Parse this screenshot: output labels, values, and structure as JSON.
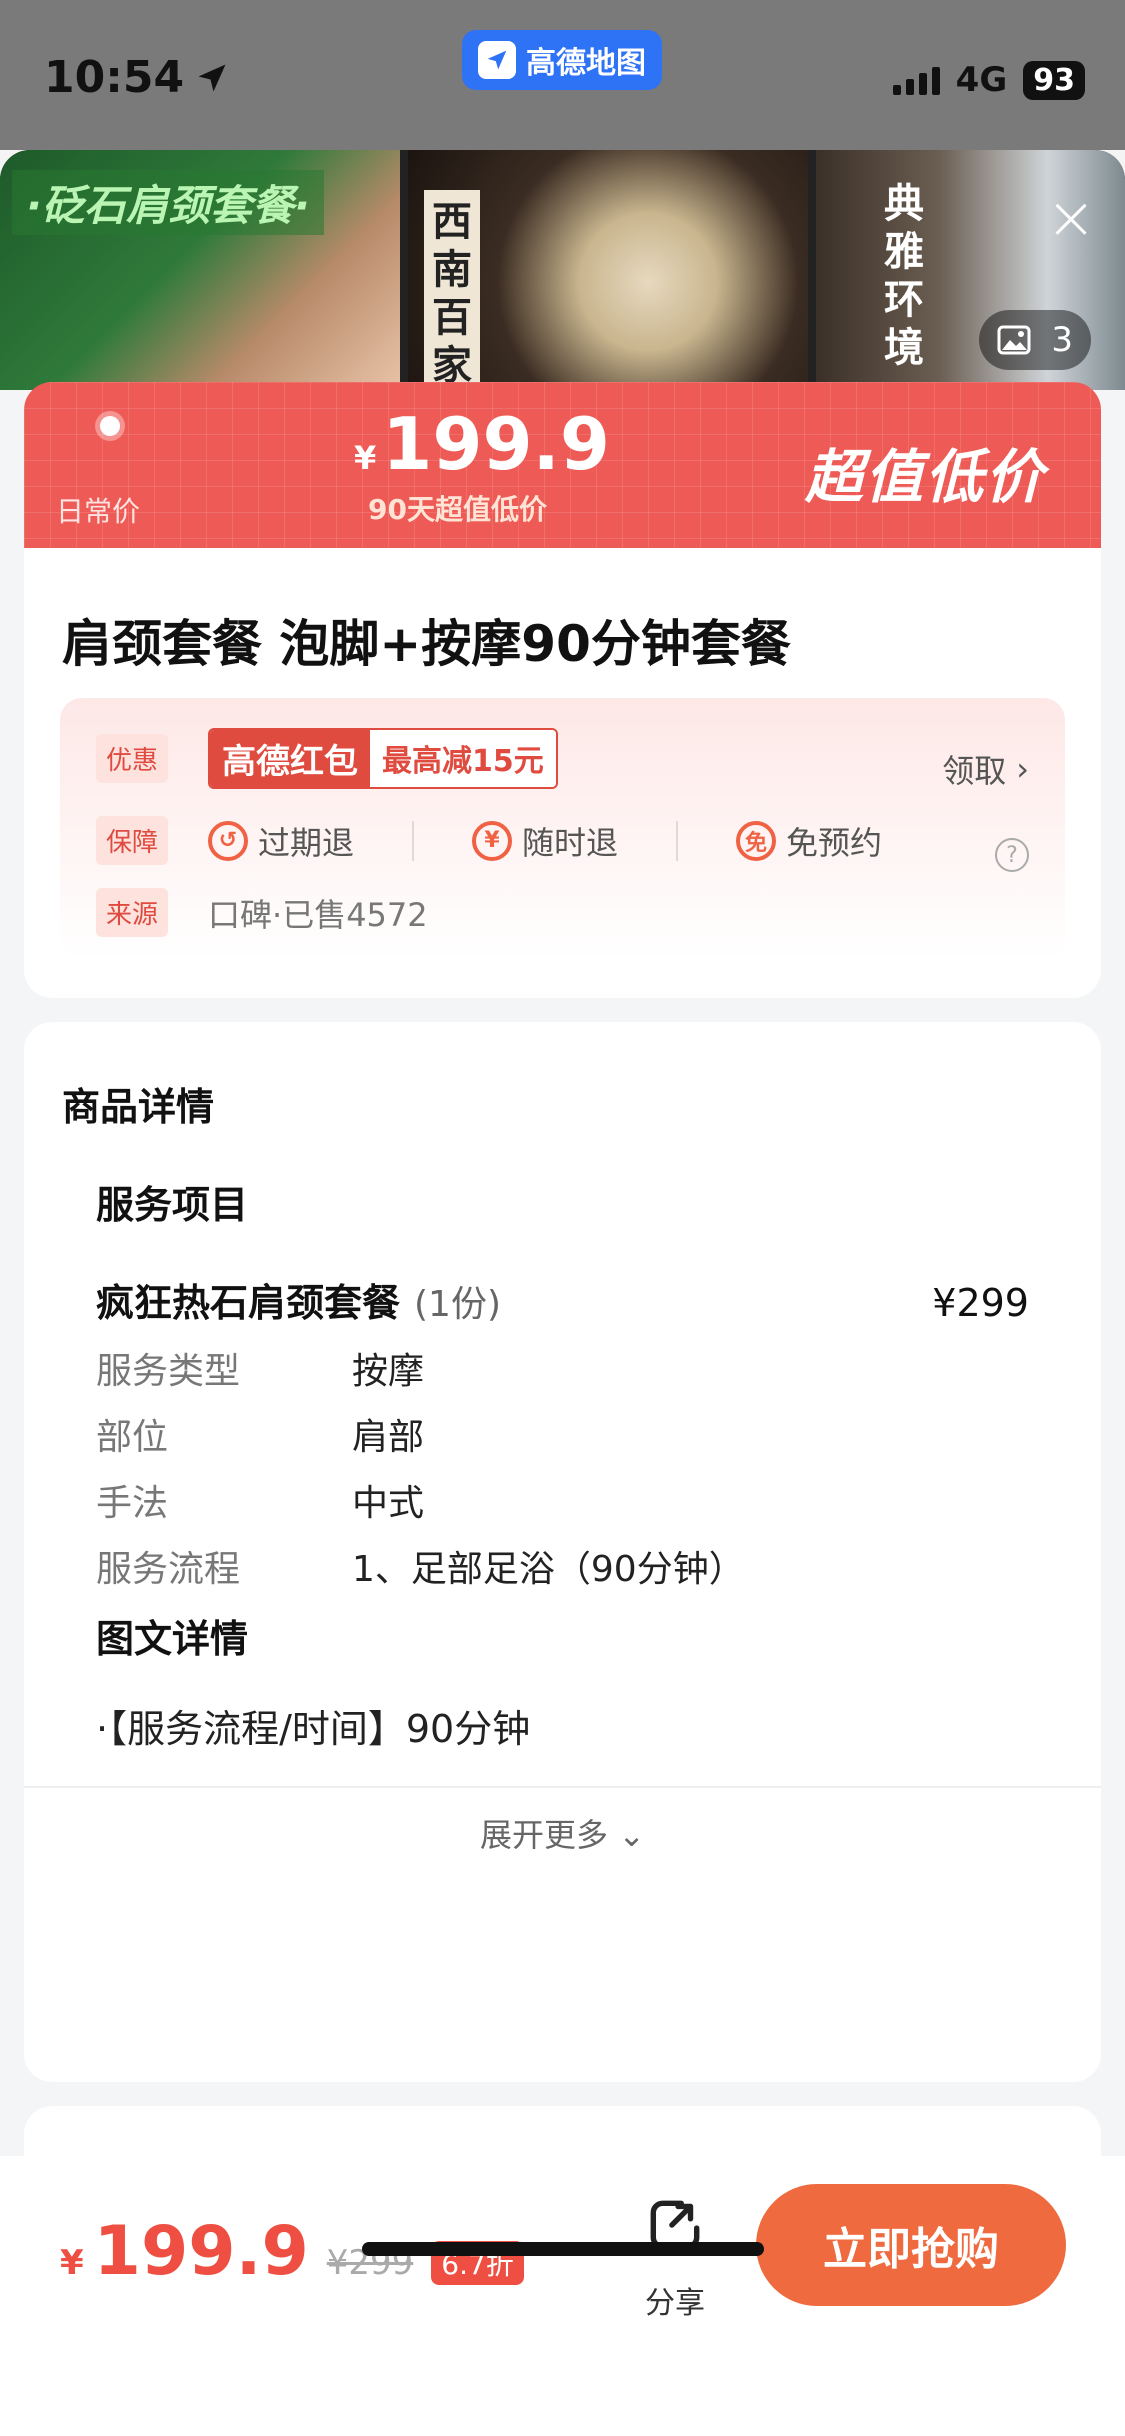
{
  "status_bar": {
    "time": "10:54",
    "app_name": "高德地图",
    "network": "4G",
    "battery": "93"
  },
  "gallery": {
    "image1_tag": "·砭石肩颈套餐·",
    "image2_text": "西南百家门店",
    "image3_text": "典雅环境",
    "photo_count": "3"
  },
  "price_banner": {
    "daily_label": "日常价",
    "currency": "¥",
    "price": "199.9",
    "price_sub": "90天超值低价",
    "slogan": "超值低价",
    "color": "#ee5a55"
  },
  "product": {
    "title": "肩颈套餐 泡脚+按摩90分钟套餐",
    "promo_label": "优惠",
    "redpacket_name": "高德红包",
    "redpacket_offer": "最高减15元",
    "claim_label": "领取",
    "guarantee_label": "保障",
    "guarantees": [
      {
        "icon": "clock-refund-icon",
        "glyph": "↺",
        "label": "过期退"
      },
      {
        "icon": "yen-refund-icon",
        "glyph": "¥",
        "label": "随时退"
      },
      {
        "icon": "no-booking-icon",
        "glyph": "免",
        "label": "免预约"
      }
    ],
    "source_label": "来源",
    "source_text": "口碑·已售4572"
  },
  "details": {
    "heading": "商品详情",
    "service_heading": "服务项目",
    "service_name": "疯狂热石肩颈套餐",
    "service_qty": "(1份)",
    "service_price": "¥299",
    "attributes": [
      {
        "key": "服务类型",
        "value": "按摩"
      },
      {
        "key": "部位",
        "value": "肩部"
      },
      {
        "key": "手法",
        "value": "中式"
      },
      {
        "key": "服务流程",
        "value": "1、足部足浴（90分钟）"
      }
    ],
    "graphic_heading": "图文详情",
    "graphic_text": "·【服务流程/时间】90分钟",
    "expand_label": "展开更多"
  },
  "bottom_bar": {
    "currency": "¥",
    "price": "199.9",
    "original_price": "¥299",
    "discount": "6.7折",
    "share_label": "分享",
    "buy_label": "立即抢购",
    "accent": "#ee4f42"
  }
}
